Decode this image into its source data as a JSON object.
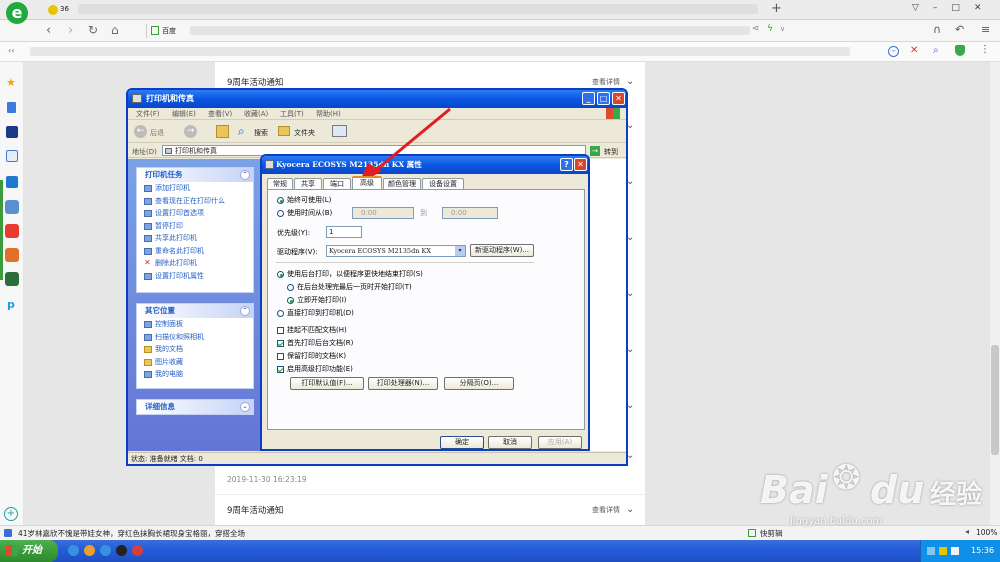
{
  "browser": {
    "tab_number": "36",
    "fav_first": "百度",
    "chevron_left": "‹‹",
    "chevron_down": "∨"
  },
  "page": {
    "article1_title": "9周年活动通知",
    "article1_more": "查看详情",
    "timestamp": "2019-11-30 16:23:19",
    "article2_title": "9周年活动通知",
    "article2_more": "查看详情"
  },
  "explorer": {
    "title": "打印机和传真",
    "menu": [
      "文件(F)",
      "编辑(E)",
      "查看(V)",
      "收藏(A)",
      "工具(T)",
      "帮助(H)"
    ],
    "back": "后退",
    "search": "搜索",
    "folders": "文件夹",
    "address_label": "地址(D)",
    "address_value": "打印机和传真",
    "go": "转到",
    "printer_tasks_title": "打印机任务",
    "printer_tasks": [
      "添加打印机",
      "查看现在正在打印什么",
      "设置打印首选项",
      "暂停打印",
      "共享此打印机",
      "重命名此打印机",
      "删除此打印机",
      "设置打印机属性"
    ],
    "other_places_title": "其它位置",
    "other_places": [
      "控制面板",
      "扫描仪和照相机",
      "我的文档",
      "图片收藏",
      "我的电脑"
    ],
    "details_title": "详细信息",
    "status": "状态: 准备就绪 文档: 0"
  },
  "dialog": {
    "title": "Kyocera ECOSYS M2135dn KX 属性",
    "tabs": [
      "常规",
      "共享",
      "端口",
      "高级",
      "颜色管理",
      "设备设置"
    ],
    "active_tab": "高级",
    "always_available": "始终可使用(L)",
    "available_from": "使用时间从(B)",
    "time_from": "0:00",
    "to": "到",
    "time_to": "0:00",
    "priority_label": "优先级(Y):",
    "priority_value": "1",
    "driver_label": "驱动程序(V):",
    "driver_value": "Kyocera ECOSYS M2135dn KX",
    "new_driver": "新驱动程序(W)...",
    "spool": "使用后台打印，以便程序更快地结束打印(S)",
    "spool_after": "在后台处理完最后一页时开始打印(T)",
    "spool_immediate": "立即开始打印(I)",
    "direct": "直接打印到打印机(D)",
    "hold_mismatched": "挂起不匹配文档(H)",
    "print_spooled_first": "首先打印后台文档(R)",
    "keep_printed": "保留打印的文档(K)",
    "advanced_features": "启用高级打印功能(E)",
    "defaults_btn": "打印默认值(F)...",
    "processor_btn": "打印处理器(N)...",
    "separator_btn": "分隔页(O)...",
    "ok": "确定",
    "cancel": "取消",
    "apply": "应用(A)"
  },
  "statusbar": {
    "news": "41岁林嘉欣不愧是带娃女神，穿红色抹胸长裙现身宝格丽，穿搭全场",
    "quick_cut": "快剪辑",
    "zoom": "100%"
  },
  "taskbar": {
    "start": "开始",
    "clock": "15:36"
  },
  "watermark": {
    "brand": "Bai",
    "brand2": "du",
    "suffix": "经验",
    "url": "jingyan.baidu.com"
  },
  "colors": {
    "xp_blue": "#0a57e3",
    "task_link": "#215dc6",
    "arrow_red": "#e02020",
    "taskbar_green": "#3a9c3a"
  }
}
